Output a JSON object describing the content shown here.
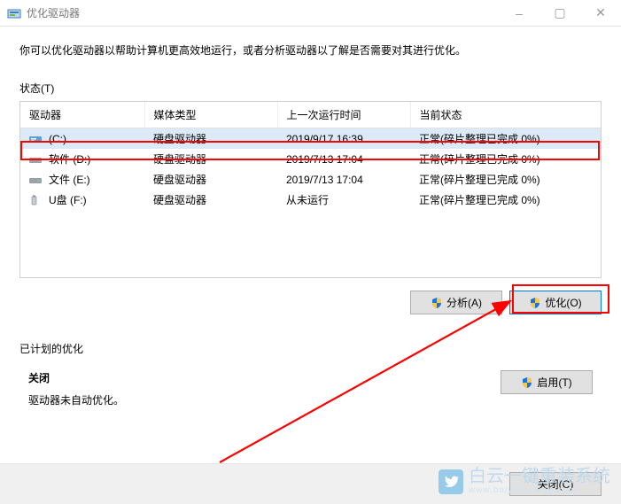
{
  "window": {
    "title": "优化驱动器",
    "minimize": "–",
    "maximize": "▢",
    "close": "✕"
  },
  "intro_text": "你可以优化驱动器以帮助计算机更高效地运行，或者分析驱动器以了解是否需要对其进行优化。",
  "status_label": "状态(T)",
  "columns": {
    "drive": "驱动器",
    "media": "媒体类型",
    "last_run": "上一次运行时间",
    "current": "当前状态"
  },
  "drives": [
    {
      "name": "(C:)",
      "media": "硬盘驱动器",
      "last_run": "2019/9/17 16:39",
      "status": "正常(碎片整理已完成 0%)",
      "icon": "c"
    },
    {
      "name": "软件 (D:)",
      "media": "硬盘驱动器",
      "last_run": "2019/7/13 17:04",
      "status": "正常(碎片整理已完成 0%)",
      "icon": "hdd"
    },
    {
      "name": "文件 (E:)",
      "media": "硬盘驱动器",
      "last_run": "2019/7/13 17:04",
      "status": "正常(碎片整理已完成 0%)",
      "icon": "hdd"
    },
    {
      "name": "U盘 (F:)",
      "media": "硬盘驱动器",
      "last_run": "从未运行",
      "status": "正常(碎片整理已完成 0%)",
      "icon": "usb"
    }
  ],
  "buttons": {
    "analyze": "分析(A)",
    "optimize": "优化(O)",
    "enable": "启用(T)",
    "close": "关闭(C)"
  },
  "schedule": {
    "label": "已计划的优化",
    "state": "关闭",
    "desc": "驱动器未自动优化。"
  },
  "watermark": {
    "main": "白云一键重装系统",
    "sub": "www.baiyunxitong.com"
  }
}
